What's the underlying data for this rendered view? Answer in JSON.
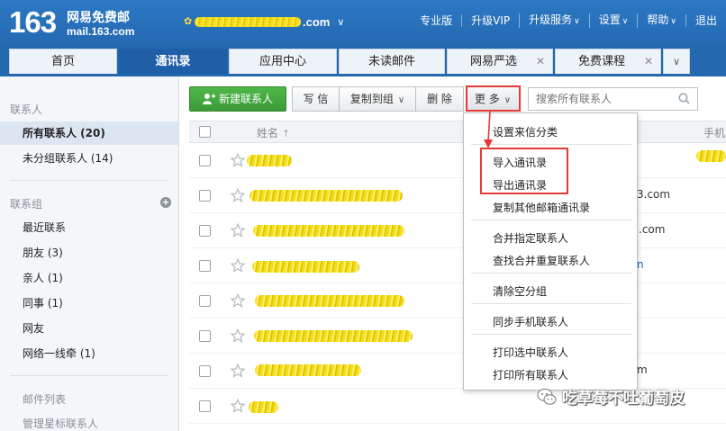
{
  "header": {
    "logo_number": "163",
    "logo_text": "网易免费邮",
    "logo_url": "mail.163.com",
    "account_suffix": ".com",
    "nav": [
      {
        "label": "专业版",
        "dropdown": false
      },
      {
        "label": "升级VIP",
        "dropdown": false
      },
      {
        "label": "升级服务",
        "dropdown": true
      },
      {
        "label": "设置",
        "dropdown": true
      },
      {
        "label": "帮助",
        "dropdown": true
      },
      {
        "label": "退出",
        "dropdown": false
      }
    ]
  },
  "tabs": [
    {
      "label": "首页",
      "closable": false,
      "active": false
    },
    {
      "label": "通讯录",
      "closable": false,
      "active": true
    },
    {
      "label": "应用中心",
      "closable": false,
      "active": false
    },
    {
      "label": "未读邮件",
      "closable": false,
      "active": false
    },
    {
      "label": "网易严选",
      "closable": true,
      "active": false
    },
    {
      "label": "免费课程",
      "closable": true,
      "active": false
    }
  ],
  "sidebar": {
    "contacts_heading": "联系人",
    "contacts_items": [
      {
        "label": "所有联系人 (20)",
        "active": true
      },
      {
        "label": "未分组联系人 (14)",
        "active": false
      }
    ],
    "groups_heading": "联系组",
    "groups_items": [
      {
        "label": "最近联系"
      },
      {
        "label": "朋友 (3)"
      },
      {
        "label": "亲人 (1)"
      },
      {
        "label": "同事 (1)"
      },
      {
        "label": "网友"
      },
      {
        "label": "网络一线牵 (1)"
      }
    ],
    "mail_list_heading": "邮件列表",
    "manage_starred": "管理星标联系人"
  },
  "toolbar": {
    "new_contact": "新建联系人",
    "write": "写 信",
    "copy_to_group": "复制到组",
    "delete": "删 除",
    "more": "更 多",
    "search_placeholder": "搜索所有联系人"
  },
  "table": {
    "col_name": "姓名",
    "col_name_sort": "↑",
    "col_phone": "手机",
    "rows": [
      {
        "email_fragment": ""
      },
      {
        "email_fragment": "3.com"
      },
      {
        "email_fragment": ".com"
      },
      {
        "email_fragment": "n"
      },
      {
        "email_fragment": ""
      },
      {
        "email_fragment": ""
      },
      {
        "email_fragment": "m"
      },
      {
        "email_fragment": ""
      }
    ]
  },
  "more_menu": {
    "items": [
      "设置来信分类",
      "导入通讯录",
      "导出通讯录",
      "复制其他邮箱通讯录",
      "合并指定联系人",
      "查找合并重复联系人",
      "清除空分组",
      "同步手机联系人",
      "打印选中联系人",
      "打印所有联系人"
    ]
  },
  "watermark": {
    "text": "吃草莓不吐葡萄皮"
  },
  "colors": {
    "brand_blue": "#2468b0",
    "primary_green": "#3b9a36",
    "highlight_red": "#e53935",
    "redaction_yellow": "#f2de1e"
  }
}
